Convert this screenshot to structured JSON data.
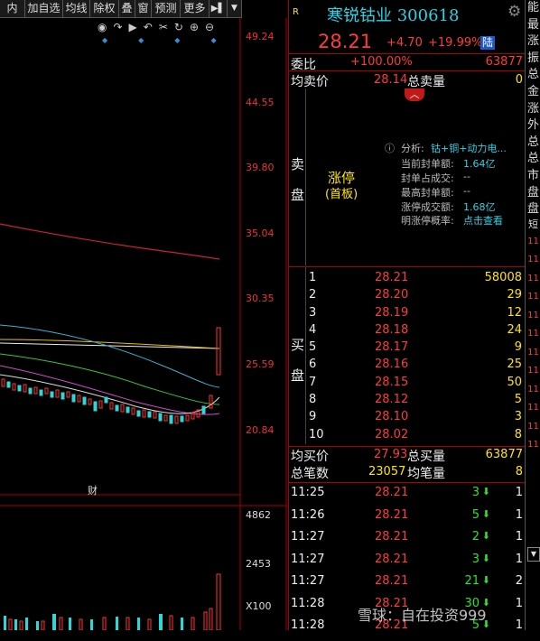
{
  "toolbar": {
    "items": [
      "内",
      "加自选",
      "均线",
      "除权",
      "叠",
      "窗",
      "预测",
      "更多",
      "▶▌",
      "▼"
    ],
    "chart_icons": [
      "eye",
      "redo",
      "play",
      "undo",
      "cut",
      "refresh",
      "zoom-in",
      "zoom-out"
    ]
  },
  "chart": {
    "price_ticks": [
      "49.24",
      "44.55",
      "39.80",
      "35.04",
      "30.35",
      "25.59",
      "20.84"
    ],
    "volume_ticks": [
      "4862",
      "2453",
      "X100"
    ],
    "cai_label": "财"
  },
  "stock": {
    "r_badge": "R",
    "name": "寒锐钴业 300618",
    "price": "28.21",
    "change": "+4.70",
    "change_pct": "+19.99%",
    "market_badge": "陆",
    "weibi_label": "委比",
    "weibi_value": "+100.00%",
    "weicha_value": "63877",
    "avg_sell_label": "均卖价",
    "avg_sell_value": "28.14",
    "total_sell_label": "总卖量",
    "total_sell_value": "0",
    "sell_side_label_1": "卖",
    "sell_side_label_2": "盘",
    "limit_up": "涨停",
    "first_board": "(首板)",
    "analysis_label": "分析:",
    "analysis_value": "钴+铜+动力电...",
    "seal_order_label": "当前封单额:",
    "seal_order_value": "1.64亿",
    "seal_ratio_label": "封单占成交:",
    "seal_ratio_value": "--",
    "max_seal_label": "最高封单额:",
    "max_seal_value": "--",
    "limit_turnover_label": "涨停成交额:",
    "limit_turnover_value": "1.68亿",
    "tomorrow_label": "明涨停概率:",
    "tomorrow_value": "点击查看",
    "buy_side_label_1": "买",
    "buy_side_label_2": "盘",
    "avg_buy_label": "均买价",
    "avg_buy_value": "27.93",
    "total_buy_label": "总买量",
    "total_buy_value": "63877",
    "total_trades_label": "总笔数",
    "total_trades_value": "23057",
    "avg_trade_label": "均笔量",
    "avg_trade_value": "8"
  },
  "bids": [
    {
      "level": "1",
      "price": "28.21",
      "vol": "58008"
    },
    {
      "level": "2",
      "price": "28.20",
      "vol": "29"
    },
    {
      "level": "3",
      "price": "28.19",
      "vol": "12"
    },
    {
      "level": "4",
      "price": "28.18",
      "vol": "24"
    },
    {
      "level": "5",
      "price": "28.17",
      "vol": "9"
    },
    {
      "level": "6",
      "price": "28.16",
      "vol": "25"
    },
    {
      "level": "7",
      "price": "28.15",
      "vol": "50"
    },
    {
      "level": "8",
      "price": "28.12",
      "vol": "5"
    },
    {
      "level": "9",
      "price": "28.10",
      "vol": "3"
    },
    {
      "level": "10",
      "price": "28.02",
      "vol": "8"
    }
  ],
  "ticks": [
    {
      "time": "11:25",
      "price": "28.21",
      "vol": "3",
      "count": "1"
    },
    {
      "time": "11:26",
      "price": "28.21",
      "vol": "5",
      "count": "1"
    },
    {
      "time": "11:27",
      "price": "28.21",
      "vol": "2",
      "count": "1"
    },
    {
      "time": "11:27",
      "price": "28.21",
      "vol": "3",
      "count": "1"
    },
    {
      "time": "11:27",
      "price": "28.21",
      "vol": "21",
      "count": "2"
    },
    {
      "time": "11:28",
      "price": "28.21",
      "vol": "30",
      "count": "1"
    },
    {
      "time": "11:28",
      "price": "28.21",
      "vol": "5",
      "count": "1"
    }
  ],
  "strip": {
    "chars": [
      "能",
      "最",
      "涨",
      "振",
      "总",
      "金",
      "涨",
      "外",
      "总",
      "总",
      "市",
      "盘",
      "盘",
      "短"
    ],
    "ticks": [
      "11",
      "11",
      "11",
      "11",
      "11",
      "11",
      "11",
      "11",
      "11",
      "11",
      "11",
      "11"
    ]
  },
  "watermark": "雪球：自在投资999",
  "colors": {
    "up": "#ff3b3b",
    "down": "#2ee32e",
    "name": "#2ad3e6",
    "accent": "#ffe600"
  }
}
